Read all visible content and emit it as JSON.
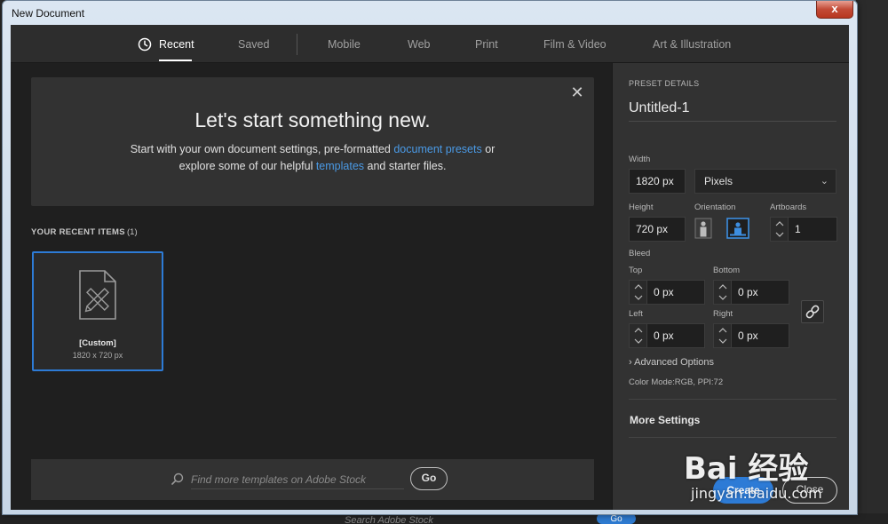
{
  "window": {
    "title": "New Document",
    "close_glyph": "x"
  },
  "tabs": [
    {
      "label": "Recent",
      "active": true,
      "icon": "clock-icon"
    },
    {
      "label": "Saved"
    },
    {
      "label": "Mobile"
    },
    {
      "label": "Web"
    },
    {
      "label": "Print"
    },
    {
      "label": "Film & Video"
    },
    {
      "label": "Art & Illustration"
    }
  ],
  "hero": {
    "title": "Let's start something new.",
    "text_1": "Start with your own document settings, pre-formatted ",
    "link_presets": "document presets",
    "text_2": " or",
    "text_3": "explore some of our helpful ",
    "link_templates": "templates",
    "text_4": " and starter files.",
    "close_glyph": "✕"
  },
  "recent": {
    "label": "YOUR RECENT ITEMS",
    "count": "(1)",
    "items": [
      {
        "name": "[Custom]",
        "size": "1820 x 720 px"
      }
    ]
  },
  "stock": {
    "placeholder": "Find more templates on Adobe Stock",
    "go_label": "Go"
  },
  "preset": {
    "heading": "PRESET DETAILS",
    "doc_name": "Untitled-1",
    "width_label": "Width",
    "width_value": "1820 px",
    "units": "Pixels",
    "height_label": "Height",
    "height_value": "720 px",
    "orientation_label": "Orientation",
    "orientation_selected": "landscape",
    "artboards_label": "Artboards",
    "artboards_value": "1",
    "bleed_label": "Bleed",
    "top_label": "Top",
    "top_value": "0 px",
    "bottom_label": "Bottom",
    "bottom_value": "0 px",
    "left_label": "Left",
    "left_value": "0 px",
    "right_label": "Right",
    "right_value": "0 px",
    "advanced_label": "Advanced Options",
    "color_mode": "Color Mode:RGB, PPI:72",
    "more_settings": "More Settings",
    "create_label": "Create",
    "close_label": "Close"
  },
  "background": {
    "search_text": "Search Adobe Stock",
    "go_label": "Go"
  },
  "watermark": {
    "main": "Bai 经验",
    "sub": "jingyan.baidu.com"
  },
  "colors": {
    "accent": "#2d7bd6",
    "link": "#4a9ae6",
    "panel_bg": "#323232",
    "main_bg": "#1f1f1f"
  }
}
